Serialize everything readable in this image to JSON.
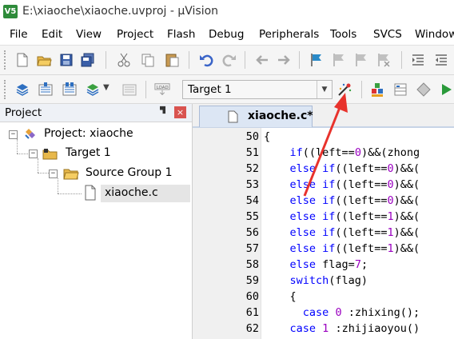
{
  "window": {
    "title": "E:\\xiaoche\\xiaoche.uvproj - µVision",
    "app_icon": "V5"
  },
  "menu": [
    "File",
    "Edit",
    "View",
    "Project",
    "Flash",
    "Debug",
    "Peripherals",
    "Tools",
    "SVCS",
    "Window"
  ],
  "toolbar1": {
    "icons": [
      "new-file-icon",
      "open-folder-icon",
      "save-icon",
      "save-all-icon",
      "cut-icon",
      "copy-icon",
      "paste-icon",
      "undo-icon",
      "redo-icon",
      "nav-back-icon",
      "nav-forward-icon",
      "bookmark-icon",
      "prev-bookmark-icon",
      "next-bookmark-icon",
      "clear-bookmarks-icon",
      "indent-icon",
      "unindent-icon"
    ]
  },
  "toolbar2": {
    "target": "Target 1",
    "icons": [
      "translate-icon",
      "build-icon",
      "rebuild-icon",
      "batch-build-icon",
      "stop-build-icon",
      "download-icon",
      "options-for-target-icon",
      "manage-components-icon",
      "select-packs-icon",
      "run-icon"
    ]
  },
  "project_panel": {
    "title": "Project",
    "pin": "ᵖ",
    "close": "×",
    "tree": {
      "root": "Project: xiaoche",
      "target": "Target 1",
      "group": "Source Group 1",
      "file": "xiaoche.c"
    }
  },
  "editor": {
    "tab": "xiaoche.c*",
    "lines": [
      {
        "n": "50",
        "segs": [
          {
            "t": "{",
            "c": ""
          }
        ]
      },
      {
        "n": "51",
        "segs": [
          {
            "t": "    ",
            "c": ""
          },
          {
            "t": "if",
            "c": "kw"
          },
          {
            "t": "((left==",
            "c": ""
          },
          {
            "t": "0",
            "c": "num"
          },
          {
            "t": ")&&(zhong",
            "c": ""
          }
        ]
      },
      {
        "n": "52",
        "segs": [
          {
            "t": "    ",
            "c": ""
          },
          {
            "t": "else if",
            "c": "kw"
          },
          {
            "t": "((left==",
            "c": ""
          },
          {
            "t": "0",
            "c": "num"
          },
          {
            "t": ")&&(",
            "c": ""
          }
        ]
      },
      {
        "n": "53",
        "segs": [
          {
            "t": "    ",
            "c": ""
          },
          {
            "t": "else if",
            "c": "kw"
          },
          {
            "t": "((left==",
            "c": ""
          },
          {
            "t": "0",
            "c": "num"
          },
          {
            "t": ")&&(",
            "c": ""
          }
        ]
      },
      {
        "n": "54",
        "segs": [
          {
            "t": "    ",
            "c": ""
          },
          {
            "t": "else if",
            "c": "kw"
          },
          {
            "t": "((left==",
            "c": ""
          },
          {
            "t": "0",
            "c": "num"
          },
          {
            "t": ")&&(",
            "c": ""
          }
        ]
      },
      {
        "n": "55",
        "segs": [
          {
            "t": "    ",
            "c": ""
          },
          {
            "t": "else if",
            "c": "kw"
          },
          {
            "t": "((left==",
            "c": ""
          },
          {
            "t": "1",
            "c": "num"
          },
          {
            "t": ")&&(",
            "c": ""
          }
        ]
      },
      {
        "n": "56",
        "segs": [
          {
            "t": "    ",
            "c": ""
          },
          {
            "t": "else if",
            "c": "kw"
          },
          {
            "t": "((left==",
            "c": ""
          },
          {
            "t": "1",
            "c": "num"
          },
          {
            "t": ")&&(",
            "c": ""
          }
        ]
      },
      {
        "n": "57",
        "segs": [
          {
            "t": "    ",
            "c": ""
          },
          {
            "t": "else if",
            "c": "kw"
          },
          {
            "t": "((left==",
            "c": ""
          },
          {
            "t": "1",
            "c": "num"
          },
          {
            "t": ")&&(",
            "c": ""
          }
        ]
      },
      {
        "n": "58",
        "segs": [
          {
            "t": "    ",
            "c": ""
          },
          {
            "t": "else",
            "c": "kw"
          },
          {
            "t": " flag=",
            "c": ""
          },
          {
            "t": "7",
            "c": "num"
          },
          {
            "t": ";",
            "c": ""
          }
        ]
      },
      {
        "n": "59",
        "segs": [
          {
            "t": "    ",
            "c": ""
          },
          {
            "t": "switch",
            "c": "kw"
          },
          {
            "t": "(flag)",
            "c": ""
          }
        ]
      },
      {
        "n": "60",
        "segs": [
          {
            "t": "    {",
            "c": ""
          }
        ]
      },
      {
        "n": "61",
        "segs": [
          {
            "t": "      ",
            "c": ""
          },
          {
            "t": "case",
            "c": "kw"
          },
          {
            "t": " ",
            "c": ""
          },
          {
            "t": "0",
            "c": "num"
          },
          {
            "t": " :zhixing();",
            "c": ""
          }
        ]
      },
      {
        "n": "62",
        "segs": [
          {
            "t": "    ",
            "c": ""
          },
          {
            "t": "case",
            "c": "kw"
          },
          {
            "t": " ",
            "c": ""
          },
          {
            "t": "1",
            "c": "num"
          },
          {
            "t": " :zhijiaoyou()",
            "c": ""
          }
        ]
      }
    ]
  },
  "colors": {
    "keyword": "#0000ff",
    "number": "#9a00c0",
    "annotation_arrow": "#e8322c"
  }
}
